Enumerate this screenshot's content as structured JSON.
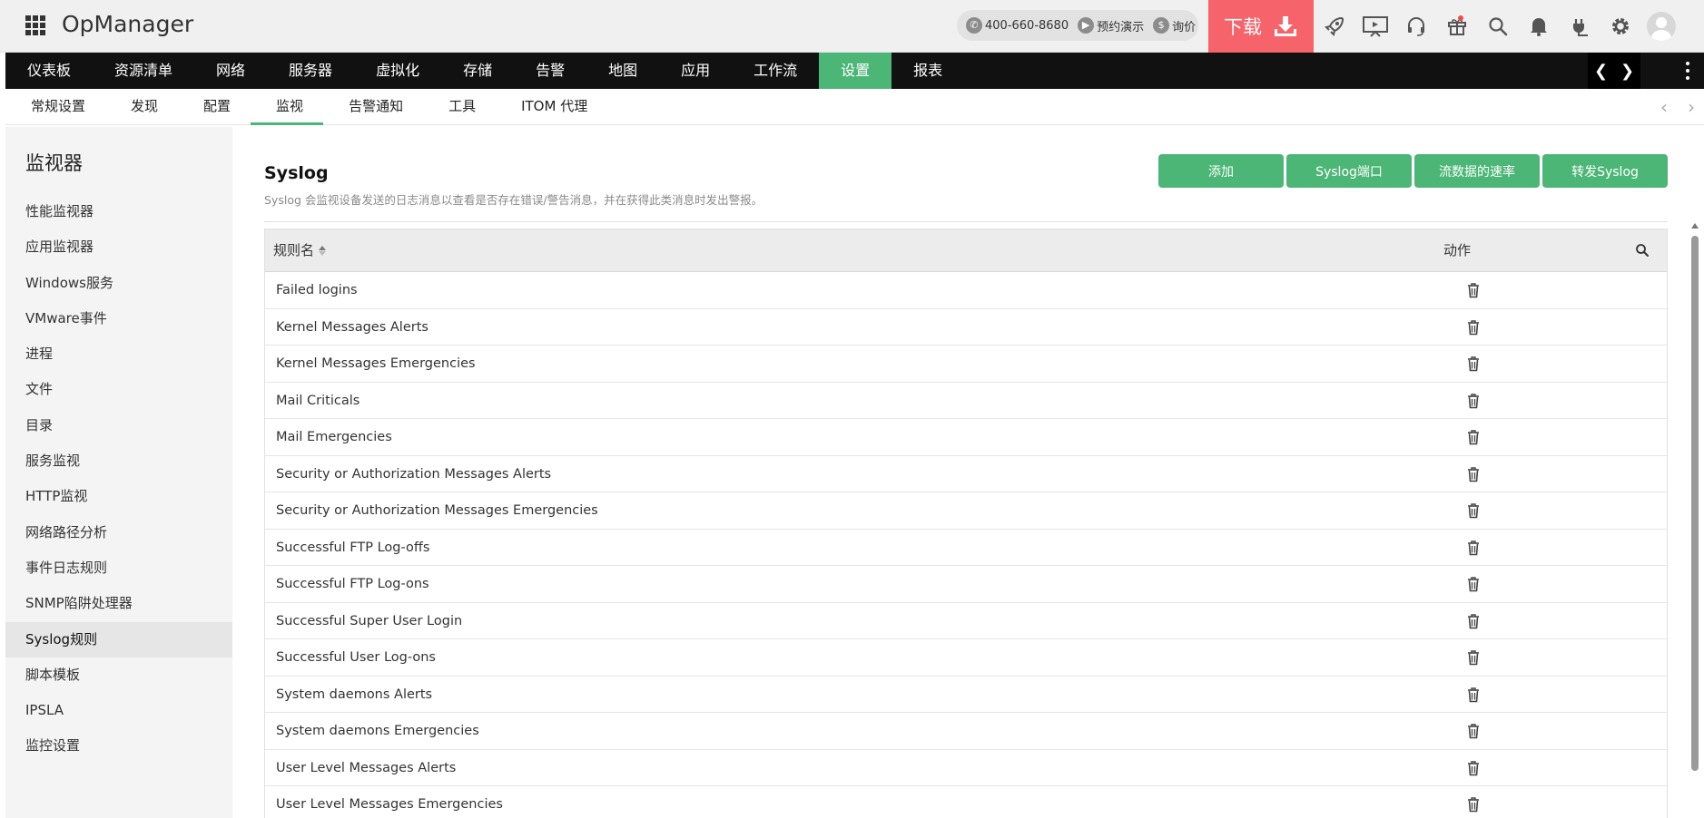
{
  "app": {
    "title": "OpManager"
  },
  "contact": {
    "phone": "400-660-8680",
    "demo": "预约演示",
    "price": "询价"
  },
  "download": {
    "label": "下载"
  },
  "top_icons": [
    "rocket-icon",
    "presentation-icon",
    "headset-icon",
    "gift-icon",
    "search-icon",
    "bell-icon",
    "plug-icon",
    "gear-icon",
    "user-avatar"
  ],
  "main_nav": {
    "items": [
      "仪表板",
      "资源清单",
      "网络",
      "服务器",
      "虚拟化",
      "存储",
      "告警",
      "地图",
      "应用",
      "工作流",
      "设置",
      "报表"
    ],
    "active": "设置"
  },
  "sub_nav": {
    "items": [
      "常规设置",
      "发现",
      "配置",
      "监视",
      "告警通知",
      "工具",
      "ITOM 代理"
    ],
    "active": "监视"
  },
  "sidebar": {
    "title": "监视器",
    "items": [
      "性能监视器",
      "应用监视器",
      "Windows服务",
      "VMware事件",
      "进程",
      "文件",
      "目录",
      "服务监视",
      "HTTP监视",
      "网络路径分析",
      "事件日志规则",
      "SNMP陷阱处理器",
      "Syslog规则",
      "脚本模板",
      "IPSLA",
      "监控设置"
    ],
    "active": "Syslog规则"
  },
  "page": {
    "title": "Syslog",
    "description": "Syslog 会监视设备发送的日志消息以查看是否存在错误/警告消息，并在获得此类消息时发出警报。"
  },
  "buttons": {
    "add": "添加",
    "syslog_port": "Syslog端口",
    "flow_rate": "流数据的速率",
    "forward_syslog": "转发Syslog"
  },
  "table": {
    "columns": {
      "name": "规则名",
      "action": "动作"
    },
    "rows": [
      "Failed logins",
      "Kernel Messages Alerts",
      "Kernel Messages Emergencies",
      "Mail Criticals",
      "Mail Emergencies",
      "Security or Authorization Messages Alerts",
      "Security or Authorization Messages Emergencies",
      "Successful FTP Log-offs",
      "Successful FTP Log-ons",
      "Successful Super User Login",
      "Successful User Log-ons",
      "System daemons Alerts",
      "System daemons Emergencies",
      "User Level Messages Alerts",
      "User Level Messages Emergencies"
    ]
  },
  "colors": {
    "accent": "#4cb676",
    "download": "#f6636a",
    "nav_bg": "#111111"
  }
}
